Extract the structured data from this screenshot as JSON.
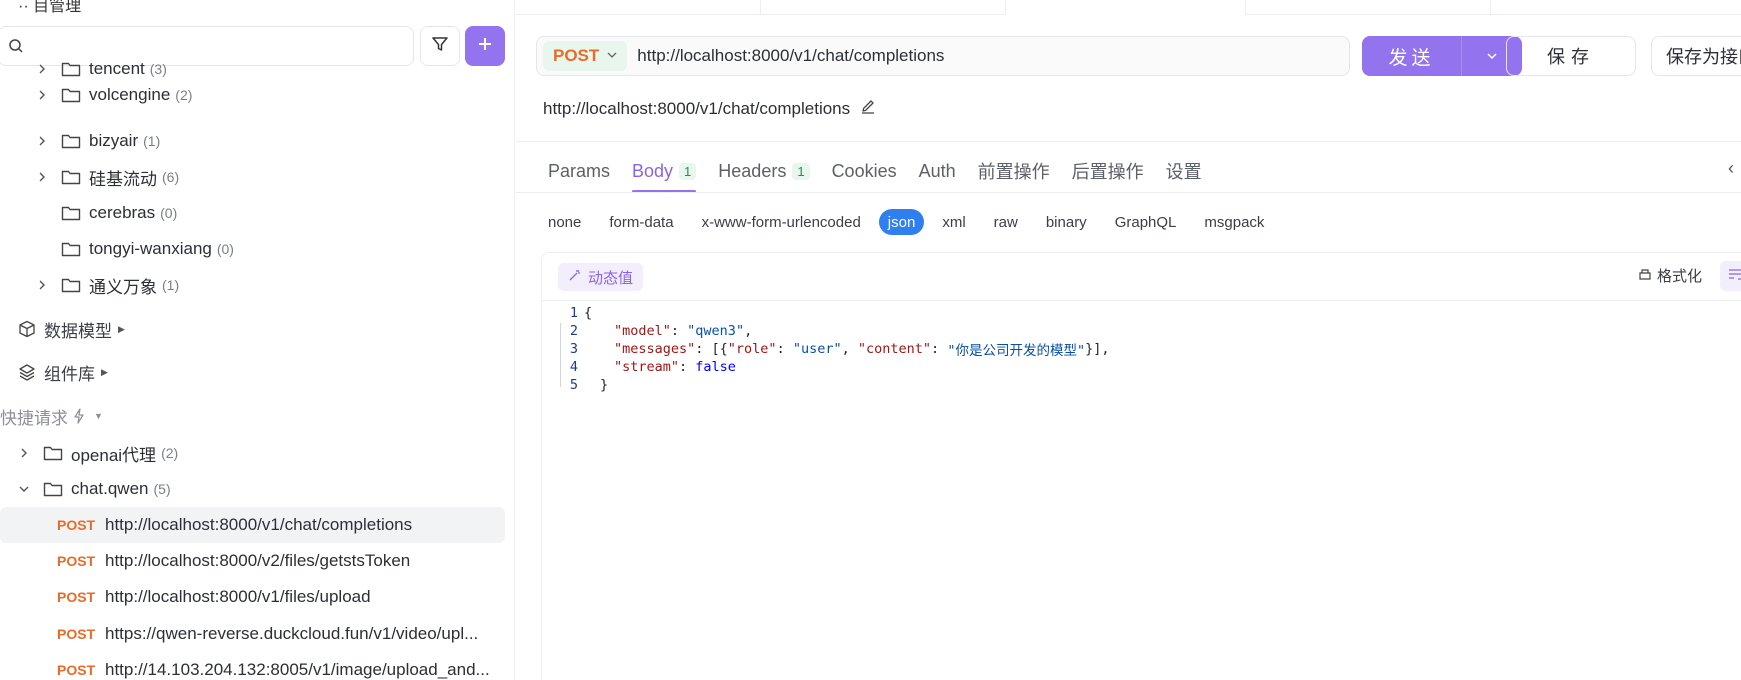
{
  "sidebar": {
    "top_fragment": "·· 目管理",
    "search": {
      "placeholder": ""
    },
    "tree_folders": [
      {
        "label": "tencent",
        "count": "(3)",
        "expandable": true
      },
      {
        "label": "volcengine",
        "count": "(2)",
        "expandable": true
      },
      {
        "label": "bizyair",
        "count": "(1)",
        "expandable": true
      },
      {
        "label": "硅基流动",
        "count": "(6)",
        "expandable": true
      },
      {
        "label": "cerebras",
        "count": "(0)",
        "expandable": false
      },
      {
        "label": "tongyi-wanxiang",
        "count": "(0)",
        "expandable": false
      },
      {
        "label": "通义万象",
        "count": "(1)",
        "expandable": true
      }
    ],
    "sections": [
      {
        "label": "数据模型",
        "icon": "cube-icon"
      },
      {
        "label": "组件库",
        "icon": "layers-icon"
      }
    ],
    "quick_requests": {
      "label": "快捷请求"
    },
    "quick_folders": [
      {
        "label": "openai代理",
        "count": "(2)",
        "expanded": false
      },
      {
        "label": "chat.qwen",
        "count": "(5)",
        "expanded": true
      }
    ],
    "requests": [
      {
        "method": "POST",
        "url": "http://localhost:8000/v1/chat/completions",
        "active": true
      },
      {
        "method": "POST",
        "url": "http://localhost:8000/v2/files/getstsToken",
        "active": false
      },
      {
        "method": "POST",
        "url": "http://localhost:8000/v1/files/upload",
        "active": false
      },
      {
        "method": "POST",
        "url": "https://qwen-reverse.duckcloud.fun/v1/video/upl...",
        "active": false
      },
      {
        "method": "POST",
        "url": "http://14.103.204.132:8005/v1/image/upload_and...",
        "active": false
      }
    ]
  },
  "request": {
    "method": "POST",
    "url": "http://localhost:8000/v1/chat/completions",
    "send_label": "发送",
    "save_label": "保存",
    "save_as_label": "保存为接口",
    "display_url": "http://localhost:8000/v1/chat/completions"
  },
  "tabs": [
    {
      "label": "Params",
      "badge": ""
    },
    {
      "label": "Body",
      "badge": "1",
      "active": true
    },
    {
      "label": "Headers",
      "badge": "1"
    },
    {
      "label": "Cookies",
      "badge": ""
    },
    {
      "label": "Auth",
      "badge": ""
    },
    {
      "label": "前置操作",
      "badge": ""
    },
    {
      "label": "后置操作",
      "badge": ""
    },
    {
      "label": "设置",
      "badge": ""
    }
  ],
  "body_types": [
    "none",
    "form-data",
    "x-www-form-urlencoded",
    "json",
    "xml",
    "raw",
    "binary",
    "GraphQL",
    "msgpack"
  ],
  "body_type_selected": "json",
  "editor": {
    "dynamic_label": "动态值",
    "format_label": "格式化",
    "line_numbers": [
      "1",
      "2",
      "3",
      "4",
      "5"
    ],
    "lines": {
      "l1": "{",
      "l2_key": "\"model\"",
      "l2_val": "\"qwen3\"",
      "l3_key": "\"messages\"",
      "l3_k_role": "\"role\"",
      "l3_v_role": "\"user\"",
      "l3_k_content": "\"content\"",
      "l3_v_content": "\"你是公司开发的模型\"",
      "l4_key": "\"stream\"",
      "l4_val": "false",
      "l5": "}"
    }
  },
  "colors": {
    "accent": "#9373ee",
    "method_post": "#ec6a27",
    "selected_body_type": "#2f7ff1"
  }
}
